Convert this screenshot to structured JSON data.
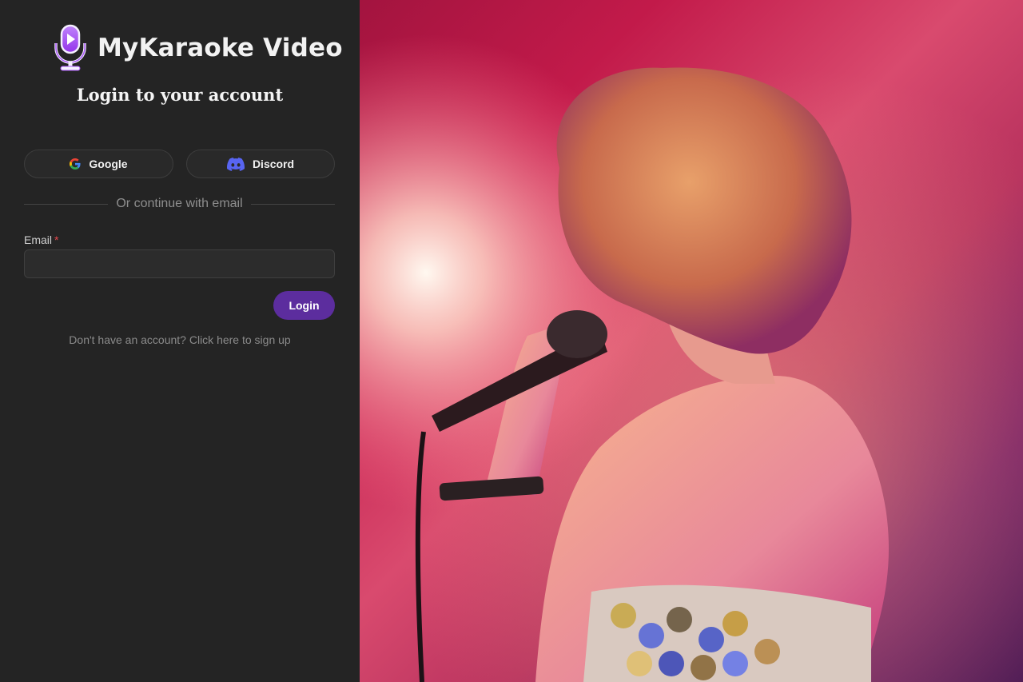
{
  "brand": {
    "name": "MyKaraoke Video",
    "logo_icon": "microphone-play-icon",
    "accent": "#a855f7"
  },
  "page": {
    "title": "Login to your account"
  },
  "oauth": {
    "google": {
      "label": "Google",
      "icon": "google-icon"
    },
    "discord": {
      "label": "Discord",
      "icon": "discord-icon",
      "color": "#5865F2"
    }
  },
  "divider": {
    "text": "Or continue with email"
  },
  "form": {
    "email_label": "Email",
    "required_mark": "*",
    "email_value": "",
    "email_placeholder": "",
    "login_label": "Login",
    "login_color": "#5c2d9e"
  },
  "signup": {
    "text": "Don't have an account? Click here to sign up"
  },
  "hero": {
    "subject": "singer-with-microphone-photo"
  }
}
